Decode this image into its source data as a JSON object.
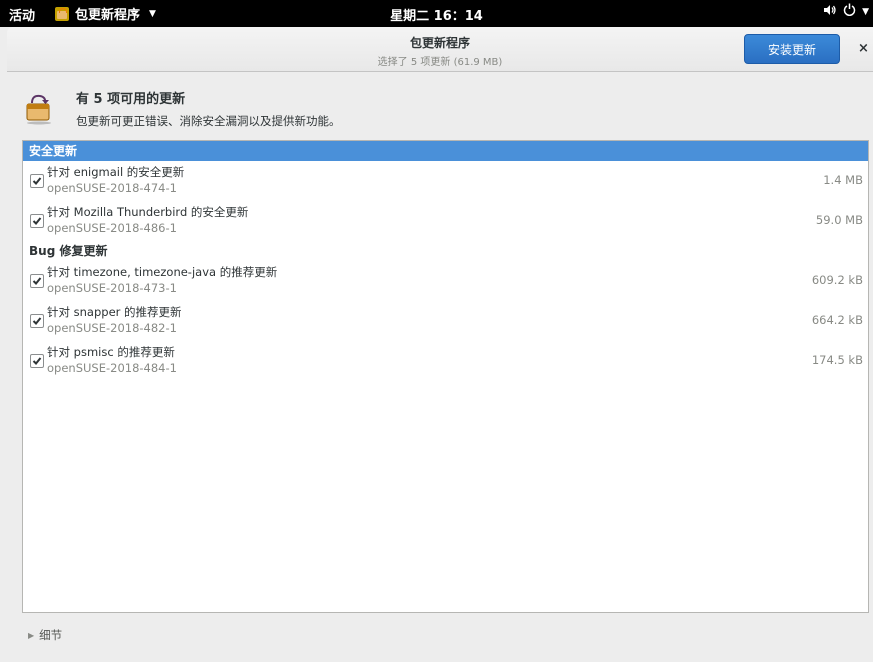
{
  "topbar": {
    "activities": "活动",
    "app_menu": "包更新程序",
    "clock": "星期二 16：14",
    "icons": [
      "volume-icon",
      "power-icon",
      "chevron-down-icon"
    ]
  },
  "window": {
    "title": "包更新程序",
    "subtitle": "选择了 5 项更新 (61.9 MB)",
    "install_button": "安装更新",
    "close_glyph": "×"
  },
  "summary": {
    "title": "有 5 项可用的更新",
    "description": "包更新可更正错误、消除安全漏洞以及提供新功能。"
  },
  "sections": [
    {
      "header": "安全更新",
      "selected": true,
      "items": [
        {
          "name": "针对 enigmail 的安全更新",
          "id": "openSUSE-2018-474-1",
          "size": "1.4 MB",
          "checked": true
        },
        {
          "name": "针对 Mozilla Thunderbird 的安全更新",
          "id": "openSUSE-2018-486-1",
          "size": "59.0 MB",
          "checked": true
        }
      ]
    },
    {
      "header": "Bug 修复更新",
      "selected": false,
      "items": [
        {
          "name": "针对 timezone, timezone-java 的推荐更新",
          "id": "openSUSE-2018-473-1",
          "size": "609.2 kB",
          "checked": true
        },
        {
          "name": "针对 snapper 的推荐更新",
          "id": "openSUSE-2018-482-1",
          "size": "664.2 kB",
          "checked": true
        },
        {
          "name": "针对 psmisc 的推荐更新",
          "id": "openSUSE-2018-484-1",
          "size": "174.5 kB",
          "checked": true
        }
      ]
    }
  ],
  "footer": {
    "details_label": "细节"
  },
  "colors": {
    "accent": "#4a90d9",
    "button": "#2a6fc2",
    "topbar": "#000000"
  }
}
